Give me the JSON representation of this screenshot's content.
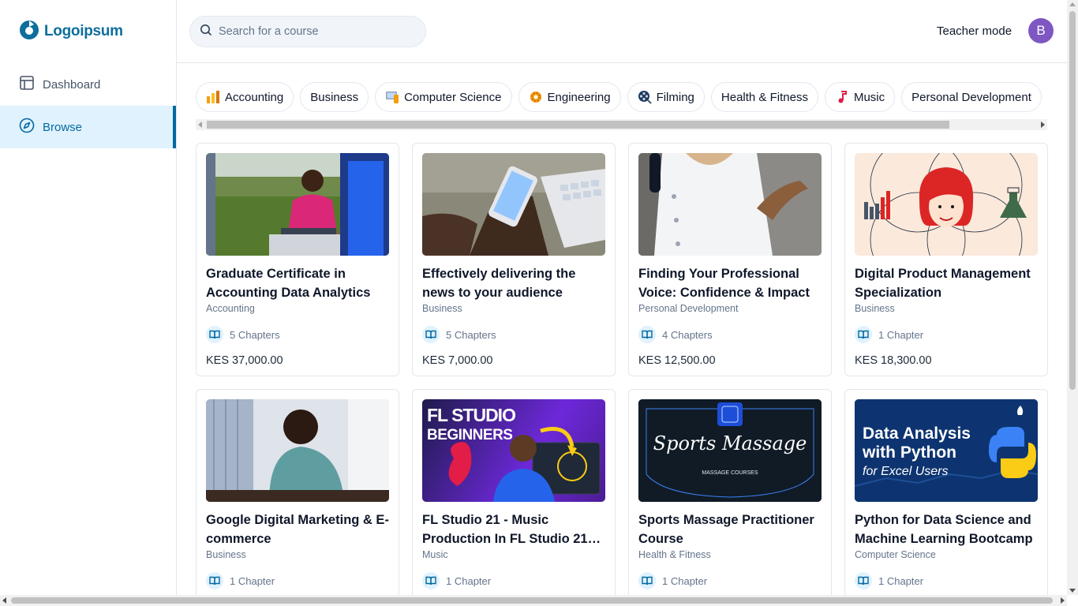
{
  "brand": {
    "name": "Logoipsum",
    "color": "#0e6e9c"
  },
  "sidebar": {
    "items": [
      {
        "label": "Dashboard",
        "icon": "layout-icon",
        "active": false
      },
      {
        "label": "Browse",
        "icon": "compass-icon",
        "active": true
      }
    ]
  },
  "topbar": {
    "search_placeholder": "Search for a course",
    "teacher_mode_label": "Teacher mode",
    "avatar_initial": "B"
  },
  "categories": [
    {
      "label": "Accounting",
      "icon": "bar-chart-emoji-icon"
    },
    {
      "label": "Business",
      "icon": ""
    },
    {
      "label": "Computer Science",
      "icon": "computer-emoji-icon"
    },
    {
      "label": "Engineering",
      "icon": "gear-emoji-icon"
    },
    {
      "label": "Filming",
      "icon": "film-reel-emoji-icon"
    },
    {
      "label": "Health & Fitness",
      "icon": ""
    },
    {
      "label": "Music",
      "icon": "music-note-emoji-icon"
    },
    {
      "label": "Personal Development",
      "icon": ""
    }
  ],
  "courses": [
    {
      "title": "Graduate Certificate in Accounting Data Analytics",
      "category": "Accounting",
      "chapters": "5 Chapters",
      "price": "KES 37,000.00",
      "image": "woman-laptop-train"
    },
    {
      "title": "Effectively delivering the news to your audience",
      "category": "Business",
      "chapters": "5 Chapters",
      "price": "KES 7,000.00",
      "image": "phone-keyboard"
    },
    {
      "title": "Finding Your Professional Voice: Confidence & Impact",
      "category": "Personal Development",
      "chapters": "4 Chapters",
      "price": "KES 12,500.00",
      "image": "speaker-microphone"
    },
    {
      "title": "Digital Product Management Specialization",
      "category": "Business",
      "chapters": "1 Chapter",
      "price": "KES 18,300.00",
      "image": "venn-illustration"
    },
    {
      "title": "Google Digital Marketing & E-commerce",
      "category": "Business",
      "chapters": "1 Chapter",
      "price": "",
      "image": "man-smiling-laptop"
    },
    {
      "title": "FL Studio 21 - Music Production In FL Studio 21 f...",
      "category": "Music",
      "chapters": "1 Chapter",
      "price": "",
      "image": "fl-studio-thumbnail",
      "image_text": [
        "FL STUDIO",
        "BEGINNERS"
      ]
    },
    {
      "title": "Sports Massage Practitioner Course",
      "category": "Health & Fitness",
      "chapters": "1 Chapter",
      "price": "",
      "image": "sports-massage-thumbnail",
      "image_text": [
        "Sports Massage",
        "MASSAGE COURSES"
      ]
    },
    {
      "title": "Python for Data Science and Machine Learning Bootcamp",
      "category": "Computer Science",
      "chapters": "1 Chapter",
      "price": "",
      "image": "python-data-analysis-thumbnail",
      "image_text": [
        "Data Analysis",
        "with Python",
        "for Excel Users"
      ]
    }
  ]
}
